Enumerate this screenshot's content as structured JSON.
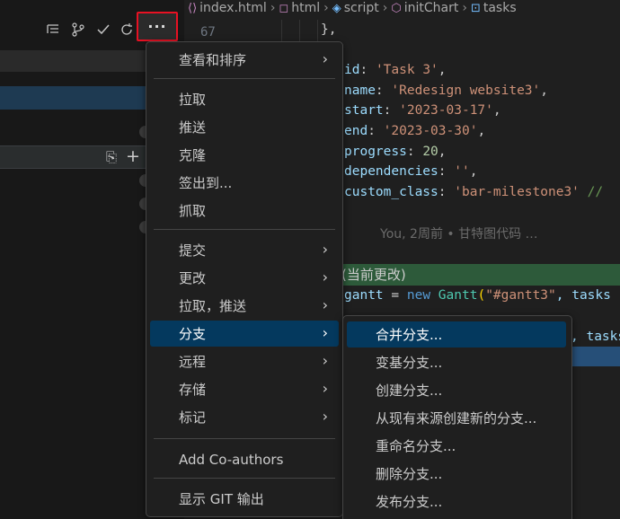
{
  "breadcrumb": {
    "file": "index.html",
    "items": [
      "html",
      "script",
      "initChart",
      "tasks"
    ]
  },
  "editor": {
    "line_number": "67",
    "code_lines": [
      {
        "parts": [
          {
            "t": "},",
            "c": "p"
          }
        ]
      },
      {
        "parts": []
      },
      {
        "parts": [
          {
            "t": "id",
            "c": "k"
          },
          {
            "t": ": ",
            "c": "p"
          },
          {
            "t": "'Task 3'",
            "c": "s"
          },
          {
            "t": ",",
            "c": "p"
          }
        ]
      },
      {
        "parts": [
          {
            "t": "name",
            "c": "k"
          },
          {
            "t": ": ",
            "c": "p"
          },
          {
            "t": "'Redesign website3'",
            "c": "s"
          },
          {
            "t": ",",
            "c": "p"
          }
        ]
      },
      {
        "parts": [
          {
            "t": "start",
            "c": "k"
          },
          {
            "t": ": ",
            "c": "p"
          },
          {
            "t": "'2023-03-17'",
            "c": "s"
          },
          {
            "t": ",",
            "c": "p"
          }
        ]
      },
      {
        "parts": [
          {
            "t": "end",
            "c": "k"
          },
          {
            "t": ": ",
            "c": "p"
          },
          {
            "t": "'2023-03-30'",
            "c": "s"
          },
          {
            "t": ",",
            "c": "p"
          }
        ]
      },
      {
        "parts": [
          {
            "t": "progress",
            "c": "k"
          },
          {
            "t": ": ",
            "c": "p"
          },
          {
            "t": "20",
            "c": "n"
          },
          {
            "t": ",",
            "c": "p"
          }
        ]
      },
      {
        "parts": [
          {
            "t": "dependencies",
            "c": "k"
          },
          {
            "t": ": ",
            "c": "p"
          },
          {
            "t": "''",
            "c": "s"
          },
          {
            "t": ",",
            "c": "p"
          }
        ]
      },
      {
        "parts": [
          {
            "t": "custom_class",
            "c": "k"
          },
          {
            "t": ": ",
            "c": "p"
          },
          {
            "t": "'bar-milestone3'",
            "c": "s"
          },
          {
            "t": " //",
            "c": "c"
          }
        ]
      }
    ],
    "blame": "You, 2周前 • 甘特图代码 …",
    "diff_banner": "(当前更改)",
    "gantt_line": [
      {
        "t": "gantt",
        "c": "k"
      },
      {
        "t": " = ",
        "c": "p"
      },
      {
        "t": "new",
        "c": "kw"
      },
      {
        "t": " ",
        "c": "p"
      },
      {
        "t": "Gantt",
        "c": "fn"
      },
      {
        "t": "(",
        "c": "br"
      },
      {
        "t": "\"#gantt3\"",
        "c": "s"
      },
      {
        "t": ", tasks",
        "c": "k"
      }
    ],
    "tasks_fragment": ", tasks"
  },
  "toolbar": {
    "more_label": "···"
  },
  "main_menu": {
    "items": [
      {
        "label": "查看和排序",
        "submenu": true
      },
      {
        "label": "拉取",
        "submenu": false
      },
      {
        "label": "推送",
        "submenu": false
      },
      {
        "label": "克隆",
        "submenu": false
      },
      {
        "label": "签出到...",
        "submenu": false
      },
      {
        "label": "抓取",
        "submenu": false
      },
      {
        "label": "提交",
        "submenu": true
      },
      {
        "label": "更改",
        "submenu": true
      },
      {
        "label": "拉取，推送",
        "submenu": true
      },
      {
        "label": "分支",
        "submenu": true,
        "active": true
      },
      {
        "label": "远程",
        "submenu": true
      },
      {
        "label": "存储",
        "submenu": true
      },
      {
        "label": "标记",
        "submenu": true
      },
      {
        "label": "Add Co-authors",
        "submenu": false
      },
      {
        "label": "显示 GIT 输出",
        "submenu": false
      }
    ]
  },
  "branch_submenu": {
    "items": [
      {
        "label": "合并分支...",
        "active": true
      },
      {
        "label": "变基分支..."
      },
      {
        "label": "创建分支..."
      },
      {
        "label": "从现有来源创建新的分支..."
      },
      {
        "label": "重命名分支..."
      },
      {
        "label": "删除分支..."
      },
      {
        "label": "发布分支..."
      }
    ]
  },
  "icons": {
    "arrow": "›"
  }
}
